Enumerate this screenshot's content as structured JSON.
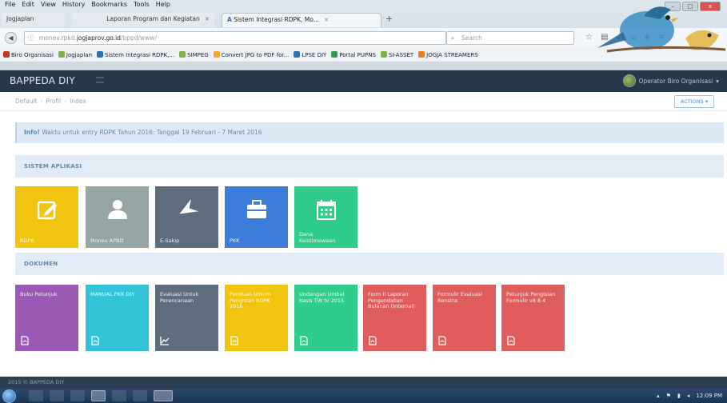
{
  "browser": {
    "menu": [
      "File",
      "Edit",
      "View",
      "History",
      "Bookmarks",
      "Tools",
      "Help"
    ],
    "tabs": [
      {
        "title": "Jogjaplan",
        "active": false
      },
      {
        "title": "Laporan Program dan Kegiatan",
        "active": false
      },
      {
        "title": "Sistem Integrasi RDPK, Mo...",
        "active": true
      }
    ],
    "new_tab": "+",
    "url_prefix": "monev.rpkd.",
    "url_host": "jogjaprov.go.id",
    "url_path": "/bppd/www/",
    "search_placeholder": "Search",
    "bookmarks": [
      {
        "label": "Biro Organisasi",
        "color": "#c0392b"
      },
      {
        "label": "Jogjaplan",
        "color": "#7cb342"
      },
      {
        "label": "Sistem Integrasi RDPK,...",
        "color": "#2e6fb5"
      },
      {
        "label": "SIMPEG",
        "color": "#7cb342"
      },
      {
        "label": "Convert JPG to PDF for...",
        "color": "#f5a623"
      },
      {
        "label": "LPSE DIY",
        "color": "#2e6fb5"
      },
      {
        "label": "Portal PUPNS",
        "color": "#2e9e4f"
      },
      {
        "label": "SI-ASSET",
        "color": "#7cb342"
      },
      {
        "label": "JOGJA STREAMERS",
        "color": "#e67e22"
      }
    ]
  },
  "app": {
    "brand": "BAPPEDA DIY",
    "user": "Operator Biro Organisasi",
    "breadcrumb": [
      "Default",
      "Profil",
      "Index"
    ],
    "actions_label": "ACTIONS",
    "info_strong": "Info!",
    "info_text": "Waktu untuk entry RDPK Tahun 2016: Tanggal 19 Februari - 7 Maret 2016",
    "sistem_title": "SISTEM APLIKASI",
    "apps": [
      {
        "label": "RDPK",
        "color": "#f1c40f",
        "icon": "edit-icon"
      },
      {
        "label": "Monev APBD",
        "color": "#95a5a6",
        "icon": "user-icon"
      },
      {
        "label": "E-Sakip",
        "color": "#5d6d7e",
        "icon": "plane-icon"
      },
      {
        "label": "PKK",
        "color": "#3b7dd8",
        "icon": "briefcase-icon"
      },
      {
        "label": "Dana Keistimewaan",
        "color": "#2fcc8b",
        "icon": "calendar-icon"
      }
    ],
    "dokumen_title": "DOKUMEN",
    "docs": [
      {
        "label": "Buku Petunjuk",
        "color": "#9b59b6",
        "icon": "document-icon"
      },
      {
        "label": "MANUAL PKK DIY",
        "color": "#33c3d9",
        "icon": "document-icon"
      },
      {
        "label": "Evaluasi Untuk Perencanaan",
        "color": "#5d6d7e",
        "icon": "line-chart-icon"
      },
      {
        "label": "Panduan Umum Pengisian RDPK 2016",
        "color": "#f1c40f",
        "icon": "document-icon"
      },
      {
        "label": "Undangan Umbal basis TW IV 2015",
        "color": "#2fcc8b",
        "icon": "document-icon"
      },
      {
        "label": "Form Il Laporan Pengendalian Bulanan (Internal)",
        "color": "#e05d5d",
        "icon": "document-icon"
      },
      {
        "label": "Formulir Evaluasi Renstra",
        "color": "#e05d5d",
        "icon": "document-icon"
      },
      {
        "label": "Petunjuk Pengisian Formulir v8 8.4",
        "color": "#e05d5d",
        "icon": "document-icon"
      }
    ],
    "footer": "2015 © BAPPEDA DIY"
  },
  "taskbar": {
    "time": "12:09 PM"
  }
}
